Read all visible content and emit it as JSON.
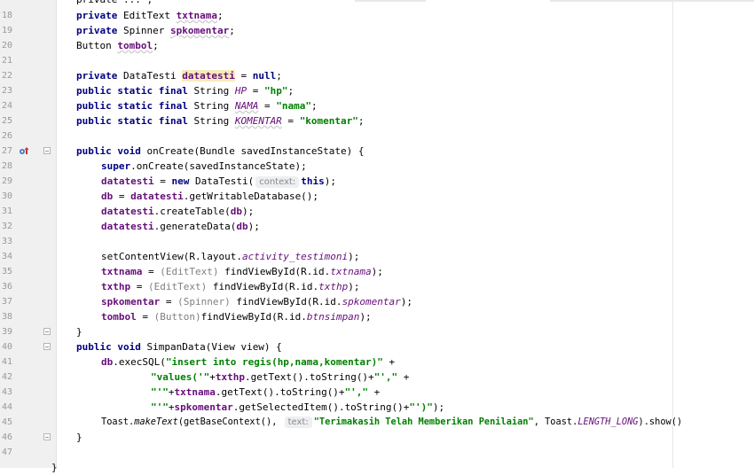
{
  "editor": {
    "top_partial_fragment": "private ... ;",
    "bottom_partial": "}",
    "lines": [
      {
        "n": "18",
        "text": "private EditText txtnama;"
      },
      {
        "n": "19",
        "text": "private Spinner spkomentar;"
      },
      {
        "n": "20",
        "text": "Button tombol;"
      },
      {
        "n": "21",
        "text": ""
      },
      {
        "n": "22",
        "text": "private DataTesti datatesti = null;"
      },
      {
        "n": "23",
        "text": "public static final String HP = \"hp\";"
      },
      {
        "n": "24",
        "text": "public static final String NAMA = \"nama\";"
      },
      {
        "n": "25",
        "text": "public static final String KOMENTAR = \"komentar\";"
      },
      {
        "n": "26",
        "text": ""
      },
      {
        "n": "27",
        "text": "public void onCreate(Bundle savedInstanceState) {"
      },
      {
        "n": "28",
        "text": "super.onCreate(savedInstanceState);"
      },
      {
        "n": "29",
        "text": "datatesti = new DataTesti( context: this);"
      },
      {
        "n": "30",
        "text": "db = datatesti.getWritableDatabase();"
      },
      {
        "n": "31",
        "text": "datatesti.createTable(db);"
      },
      {
        "n": "32",
        "text": "datatesti.generateData(db);"
      },
      {
        "n": "33",
        "text": ""
      },
      {
        "n": "34",
        "text": "setContentView(R.layout.activity_testimoni);"
      },
      {
        "n": "35",
        "text": "txtnama = (EditText) findViewById(R.id.txtnama);"
      },
      {
        "n": "36",
        "text": "txthp = (EditText) findViewById(R.id.txthp);"
      },
      {
        "n": "37",
        "text": "spkomentar = (Spinner) findViewById(R.id.spkomentar);"
      },
      {
        "n": "38",
        "text": "tombol = (Button)findViewById(R.id.btnsimpan);"
      },
      {
        "n": "39",
        "text": "}"
      },
      {
        "n": "40",
        "text": "public void SimpanData(View view) {"
      },
      {
        "n": "41",
        "text": "db.execSQL(\"insert into regis(hp,nama,komentar)\" +"
      },
      {
        "n": "42",
        "text": "\"values('\"+txthp.getText().toString()+\"',\" +"
      },
      {
        "n": "43",
        "text": "\"'\"+txtnama.getText().toString()+\"',\" +"
      },
      {
        "n": "44",
        "text": "\"'\"+spkomentar.getSelectedItem().toString()+\"')\");"
      },
      {
        "n": "45",
        "text": "Toast.makeText(getBaseContext(),  text: \"Terimakasih Telah Memberikan Penilaian\", Toast.LENGTH_LONG).show()"
      },
      {
        "n": "46",
        "text": "}"
      },
      {
        "n": "47",
        "text": ""
      }
    ],
    "hints": {
      "context": "context:",
      "text": "text:"
    },
    "gutter_icons": {
      "override": "override-up-arrow-icon"
    }
  },
  "colors": {
    "keyword": "#000080",
    "field": "#660e7a",
    "string": "#008000",
    "gutter_bg": "#f0f0f0",
    "highlight": "#f6ebbc"
  }
}
